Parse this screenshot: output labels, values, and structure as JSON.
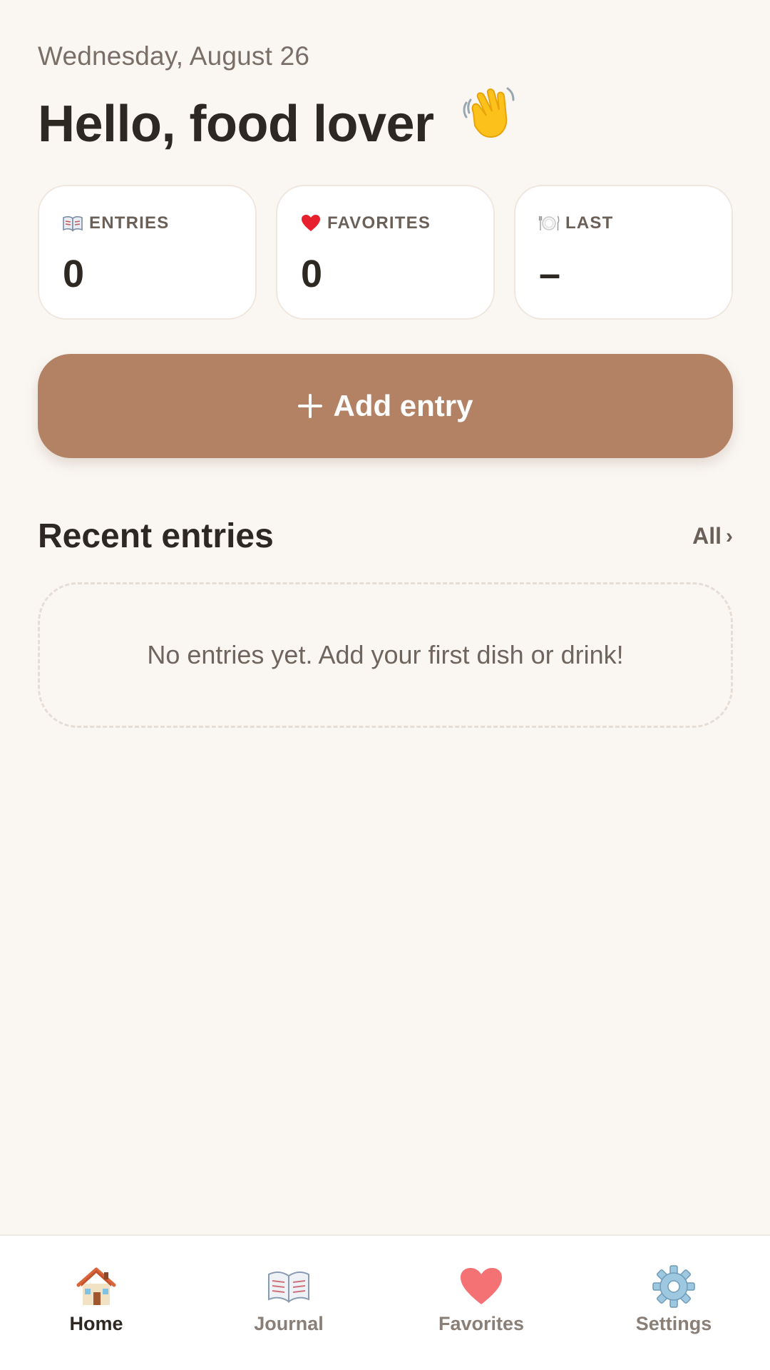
{
  "header": {
    "date": "Wednesday, August 26",
    "greeting": "Hello, food lover",
    "greeting_emoji": "wave-hand-icon"
  },
  "stats": [
    {
      "icon": "open-book-icon",
      "label": "ENTRIES",
      "value": "0"
    },
    {
      "icon": "heart-icon",
      "label": "FAVORITES",
      "value": "0"
    },
    {
      "icon": "plate-icon",
      "label": "LAST",
      "value": "–"
    }
  ],
  "actions": {
    "add_label": "Add entry",
    "add_icon": "plus-icon"
  },
  "recent": {
    "title": "Recent entries",
    "all_label": "All",
    "all_chevron": "›",
    "empty_message": "No entries yet. Add your first dish or drink!"
  },
  "tabs": [
    {
      "icon": "house-icon",
      "label": "Home",
      "active": true
    },
    {
      "icon": "open-book-icon",
      "label": "Journal",
      "active": false
    },
    {
      "icon": "heart-icon",
      "label": "Favorites",
      "active": false
    },
    {
      "icon": "gear-icon",
      "label": "Settings",
      "active": false
    }
  ],
  "colors": {
    "background": "#faf7f3",
    "accent": "#b38265",
    "text_primary": "#2e2823",
    "text_secondary": "#6b6058",
    "heart": "#f47174"
  }
}
